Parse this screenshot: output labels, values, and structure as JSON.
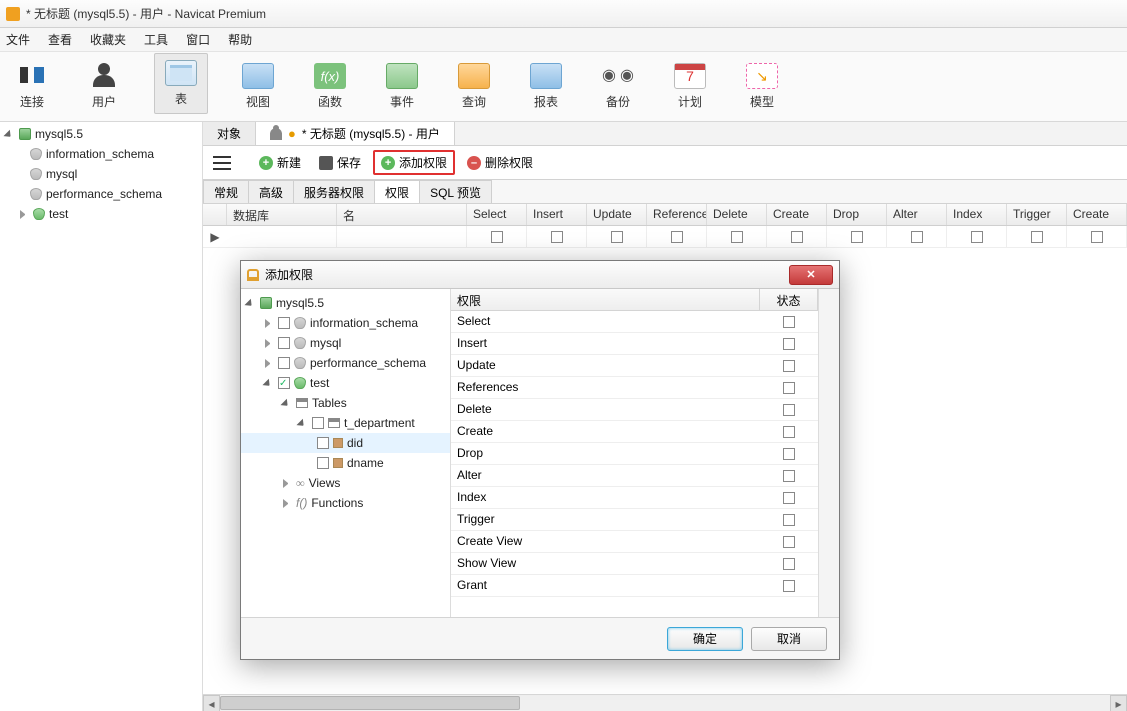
{
  "window": {
    "title": "* 无标题 (mysql5.5) - 用户 - Navicat Premium"
  },
  "menu": {
    "file": "文件",
    "view": "查看",
    "bookmark": "收藏夹",
    "tools": "工具",
    "window": "窗口",
    "help": "帮助"
  },
  "toolbar": {
    "connect": "连接",
    "user": "用户",
    "table": "表",
    "view": "视图",
    "function": "函数",
    "event": "事件",
    "query": "查询",
    "report": "报表",
    "backup": "备份",
    "schedule": "计划",
    "model": "模型"
  },
  "left_tree": {
    "server": "mysql5.5",
    "dbs": [
      "information_schema",
      "mysql",
      "performance_schema",
      "test"
    ]
  },
  "doc_tabs": {
    "objects": "对象",
    "current": "* 无标题 (mysql5.5) - 用户"
  },
  "actionbar": {
    "new": "新建",
    "save": "保存",
    "add_priv": "添加权限",
    "del_priv": "删除权限"
  },
  "subtabs": {
    "general": "常规",
    "advanced": "高级",
    "server_priv": "服务器权限",
    "priv": "权限",
    "sql_preview": "SQL 预览"
  },
  "grid": {
    "cols": [
      "数据库",
      "名",
      "Select",
      "Insert",
      "Update",
      "Reference",
      "Delete",
      "Create",
      "Drop",
      "Alter",
      "Index",
      "Trigger",
      "Create"
    ]
  },
  "dialog": {
    "title": "添加权限",
    "tree": {
      "server": "mysql5.5",
      "dbs": [
        "information_schema",
        "mysql",
        "performance_schema"
      ],
      "test": "test",
      "tables_label": "Tables",
      "table": "t_department",
      "cols": [
        "did",
        "dname"
      ],
      "views": "Views",
      "functions": "Functions"
    },
    "right_head": {
      "priv": "权限",
      "status": "状态"
    },
    "privs": [
      "Select",
      "Insert",
      "Update",
      "References",
      "Delete",
      "Create",
      "Drop",
      "Alter",
      "Index",
      "Trigger",
      "Create View",
      "Show View",
      "Grant"
    ],
    "ok": "确定",
    "cancel": "取消"
  }
}
